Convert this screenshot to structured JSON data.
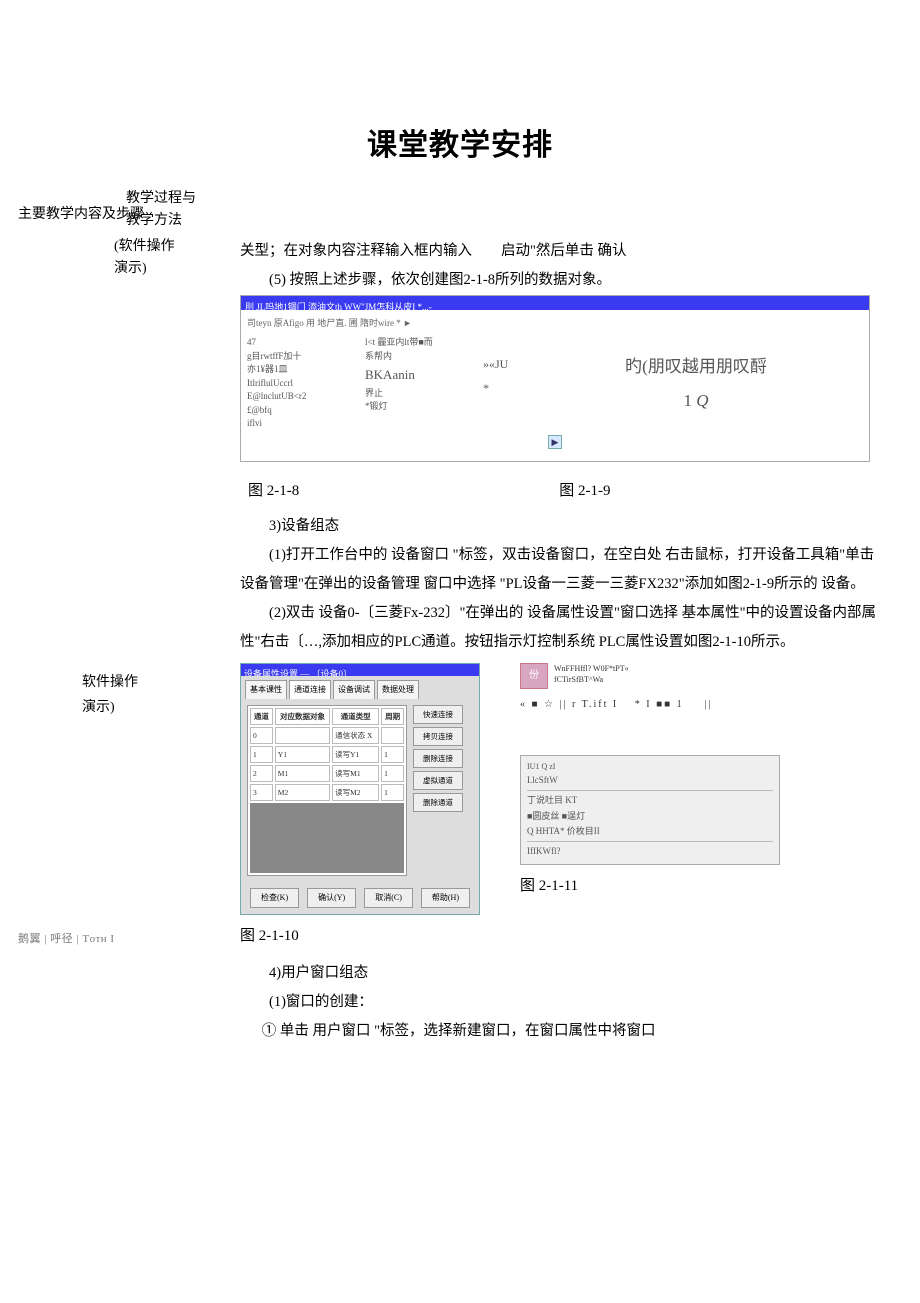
{
  "title": "课堂教学安排",
  "sidebar": {
    "col_a": "主要教学内容及步骤",
    "col_b_l1": "教学过程与",
    "col_b_l2": "教学方法",
    "note1": "(软件操作",
    "note2": "演示)",
    "op_demo1": "软件操作",
    "op_demo2": "演示)",
    "footer": "鹅翼 | 呼径 | Tотн I"
  },
  "body": {
    "p1": "关型；在对象内容注释输入框内输入　　启动\"然后单击 确认",
    "p2": "(5) 按照上述步骤，依次创建图2-1-8所列的数据对象。",
    "fig218": {
      "titlebar": "刖 JL吗地1锢门 添油文th WW\"JM怎科从皮I *...-",
      "row1": "司teyn 原Afigo 用 地尸直. 圃 隋时wire * ►",
      "col1": [
        "47",
        "g目rwtffF加十",
        "亦1¥器1皿",
        "ItlriflulUccrl",
        "E@lnclutUB<r2",
        "£@bfq",
        "iflvi"
      ],
      "col2": [
        "l<t 霾亚内lt带■而",
        "系帮内",
        "BKAanin",
        "界止",
        "*锻灯"
      ],
      "col3": [
        "»«JU",
        "*"
      ],
      "col4_l1": "旳(朋叹越用朋叹酹",
      "col4_l2_a": "1 ",
      "col4_l2_b": "Q"
    },
    "cap_218": "图 2-1-8",
    "cap_219": "图 2-1-9",
    "s3_head": "3)设备组态",
    "s3_p1": "(1)打开工作台中的 设备窗口 \"标签，双击设备窗口，在空白处 右击鼠标，打开设备工具箱\"单击设备管理\"在弹出的设备管理 窗口中选择 \"PL设备一三菱一三菱FX232\"添加如图2-1-9所示的 设备。",
    "s3_p2": "(2)双击 设备0-〔三菱Fx-232〕\"在弹出的 设备属性设置\"窗口选择 基本属性\"中的设置设备内部属性\"右击〔…,添加相应的PLC通道。按钮指示灯控制系统 PLC属性设置如图2-1-10所示。",
    "fig2110": {
      "titlebar": "设备属性设置 — 〔设备0〕",
      "tabs": [
        "基本课性",
        "通道连接",
        "设备调试",
        "数据处理"
      ],
      "headers": [
        "通道",
        "对应数据对象",
        "通道类型",
        "周期"
      ],
      "rows": [
        [
          "0",
          "",
          "通信状态 X",
          ""
        ],
        [
          "1",
          "Y1",
          "读写Y1",
          "1"
        ],
        [
          "2",
          "M1",
          "读写M1",
          "1"
        ],
        [
          "3",
          "M2",
          "读写M2",
          "1"
        ]
      ],
      "btns": [
        "快速连接",
        "拷贝连接",
        "删除连接",
        "虚拟通道",
        "删除通道"
      ],
      "foot": [
        "检查(K)",
        "确认(Y)",
        "取消(C)",
        "帮助(H)"
      ]
    },
    "cap_2110": "图 2-1-10",
    "fig2111": {
      "chip": "份",
      "meta_l1": "WnFFHffl? W0F*tPT«",
      "meta_l2": "fCTirSfBT^Wa",
      "line": "« ■ ☆ || r T.ift I 　* I ■■ 1 　 ||",
      "box": [
        "IU1                         Q             zI",
        "I.lcSftW",
        "丁说吐目  KT",
        "■圆皮丝                            ■逞灯",
        "Q HHTA*                        价枚目II",
        "IfIKWfl?"
      ]
    },
    "cap_2111": "图 2-1-11",
    "s4_head": "4)用户窗口组态",
    "s4_p1": "(1)窗口的创建：",
    "s4_p2": "① 单击 用户窗口 \"标签，选择新建窗口，在窗口属性中将窗口"
  }
}
